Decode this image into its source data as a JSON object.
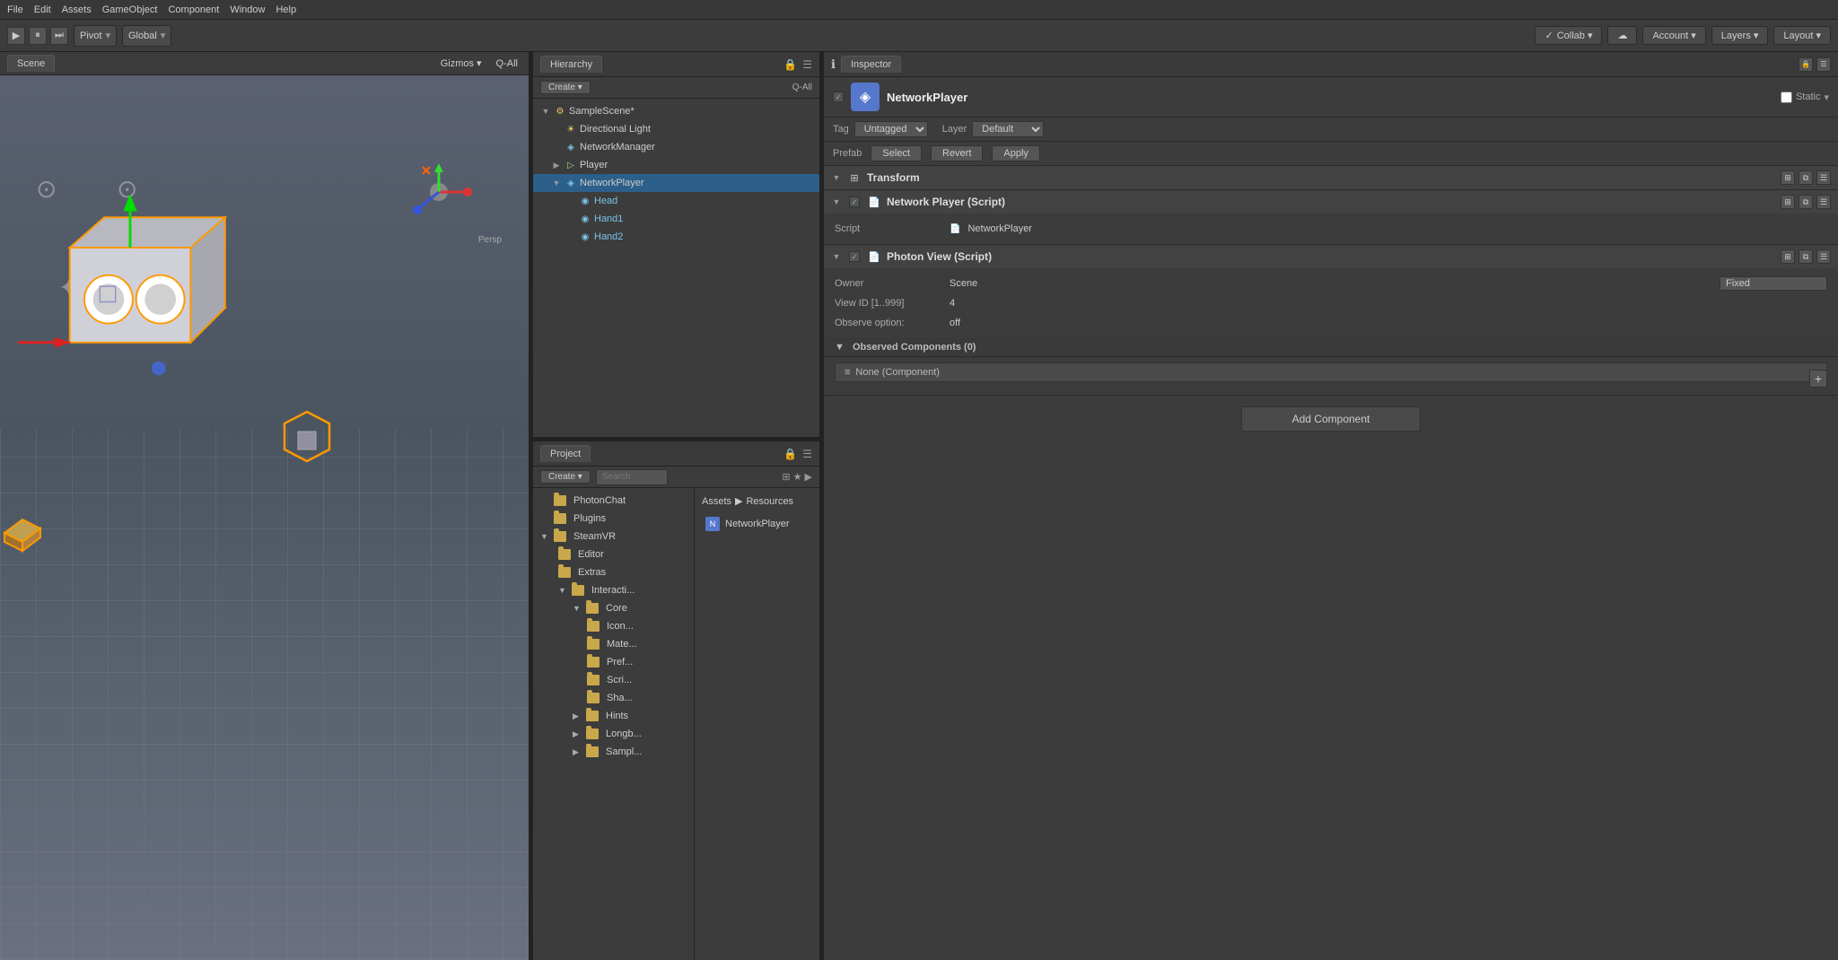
{
  "menubar": {
    "items": [
      "File",
      "Edit",
      "Assets",
      "GameObject",
      "Component",
      "Window",
      "Help"
    ]
  },
  "toolbar": {
    "pivot_label": "Pivot",
    "global_label": "Global",
    "collab_label": "Collab ▾",
    "account_label": "Account ▾",
    "layers_label": "Layers ▾",
    "layout_label": "Layout ▾"
  },
  "scene": {
    "tab_label": "Scene",
    "gizmos_label": "Gizmos ▾",
    "all_label": "Q-All",
    "persp_label": "Persp"
  },
  "hierarchy": {
    "tab_label": "Hierarchy",
    "create_label": "Create ▾",
    "all_label": "Q-All",
    "root_scene": "SampleScene*",
    "items": [
      {
        "label": "Directional Light",
        "indent": 1,
        "icon": "light",
        "expanded": false
      },
      {
        "label": "NetworkManager",
        "indent": 1,
        "icon": "net",
        "expanded": false
      },
      {
        "label": "Player",
        "indent": 1,
        "icon": "player",
        "expanded": false,
        "expand_arrow": "▶"
      },
      {
        "label": "NetworkPlayer",
        "indent": 1,
        "icon": "net",
        "expanded": true,
        "expand_arrow": "▼",
        "selected": true
      },
      {
        "label": "Head",
        "indent": 2,
        "icon": "head",
        "highlighted": true
      },
      {
        "label": "Hand1",
        "indent": 2,
        "icon": "hand",
        "highlighted": true
      },
      {
        "label": "Hand2",
        "indent": 2,
        "icon": "hand",
        "highlighted": true
      }
    ]
  },
  "project": {
    "tab_label": "Project",
    "create_label": "Create ▾",
    "breadcrumb_assets": "Assets",
    "breadcrumb_sep": "▶",
    "breadcrumb_resources": "Resources",
    "tree_items": [
      {
        "label": "PhotonChat",
        "indent": 1
      },
      {
        "label": "Plugins",
        "indent": 1
      },
      {
        "label": "SteamVR",
        "indent": 1,
        "expanded": true,
        "expand_arrow": "▼"
      },
      {
        "label": "Editor",
        "indent": 2
      },
      {
        "label": "Extras",
        "indent": 2
      },
      {
        "label": "Interacti...",
        "indent": 2,
        "expanded": true,
        "expand_arrow": "▼"
      },
      {
        "label": "Core",
        "indent": 3,
        "expanded": true,
        "expand_arrow": "▼"
      },
      {
        "label": "Icon...",
        "indent": 4
      },
      {
        "label": "Mate...",
        "indent": 4
      },
      {
        "label": "Pref...",
        "indent": 4
      },
      {
        "label": "Scri...",
        "indent": 4
      },
      {
        "label": "Sha...",
        "indent": 4
      },
      {
        "label": "Hints",
        "indent": 3,
        "expand_arrow": "▶"
      },
      {
        "label": "Longb...",
        "indent": 3,
        "expand_arrow": "▶"
      },
      {
        "label": "Sampl...",
        "indent": 3,
        "expand_arrow": "▶"
      }
    ],
    "asset_items": [
      {
        "label": "NetworkPlayer",
        "type": "script"
      }
    ]
  },
  "inspector": {
    "tab_label": "Inspector",
    "object_name": "NetworkPlayer",
    "static_label": "Static",
    "tag_label": "Tag",
    "tag_value": "Untagged",
    "layer_label": "Layer",
    "layer_value": "Default",
    "prefab_label": "Prefab",
    "select_label": "Select",
    "revert_label": "Revert",
    "apply_label": "Apply",
    "components": [
      {
        "name": "Transform",
        "icon": "⊞",
        "type": "transform"
      },
      {
        "name": "Network Player (Script)",
        "icon": "📄",
        "type": "script",
        "fields": [
          {
            "label": "Script",
            "value": "NetworkPlayer"
          }
        ]
      },
      {
        "name": "Photon View (Script)",
        "icon": "📄",
        "type": "script",
        "fields": [
          {
            "label": "Owner",
            "value": "Scene",
            "right_value": "Fixed"
          },
          {
            "label": "View ID [1..999]",
            "value": "4"
          },
          {
            "label": "Observe option:",
            "value": "off"
          }
        ],
        "observed_label": "Observed Components (0)",
        "none_component": "None (Component)"
      }
    ],
    "add_component_label": "Add Component"
  }
}
